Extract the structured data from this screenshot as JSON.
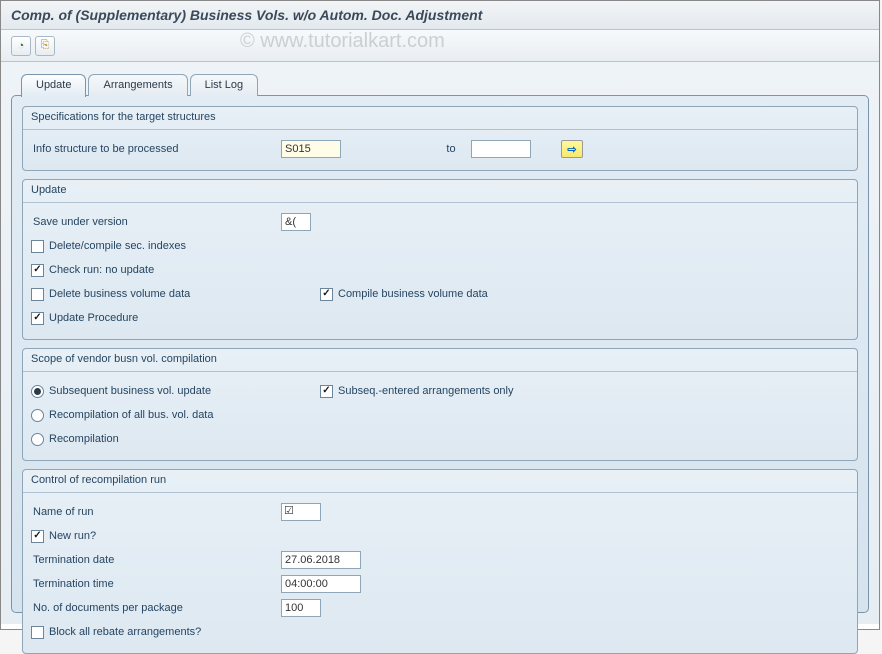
{
  "window": {
    "title": "Comp. of (Supplementary) Business Vols. w/o Autom. Doc. Adjustment"
  },
  "toolbar": {
    "execute_icon": "⊕",
    "variants_icon": "⎘"
  },
  "tabs": {
    "update": "Update",
    "arrangements": "Arrangements",
    "listlog": "List Log"
  },
  "spec": {
    "group_title": "Specifications for the target structures",
    "info_structure_label": "Info structure to be processed",
    "info_structure_value": "S015",
    "to_label": "to",
    "info_structure_to": "",
    "multi_arrow": "⇨"
  },
  "update": {
    "group_title": "Update",
    "save_version_label": "Save under version",
    "save_version_value": "&(",
    "delete_compile_indexes": "Delete/compile sec. indexes",
    "check_run": "Check run: no update",
    "delete_bv": "Delete business volume data",
    "compile_bv": "Compile business volume data",
    "update_proc": "Update Procedure"
  },
  "scope": {
    "group_title": "Scope of vendor busn vol. compilation",
    "subsequent_update": "Subsequent business vol. update",
    "subseq_entered": "Subseq.-entered arrangements only",
    "recomp_all": "Recompilation of all bus. vol. data",
    "recomp": "Recompilation"
  },
  "control": {
    "group_title": "Control of recompilation run",
    "name_label": "Name of run",
    "name_value": "",
    "new_run": "New run?",
    "term_date_label": "Termination date",
    "term_date_value": "27.06.2018",
    "term_time_label": "Termination time",
    "term_time_value": "04:00:00",
    "docs_per_pkg_label": "No. of documents per package",
    "docs_per_pkg_value": "100",
    "block_rebate": "Block all rebate arrangements?"
  },
  "watermark": "© www.tutorialkart.com"
}
